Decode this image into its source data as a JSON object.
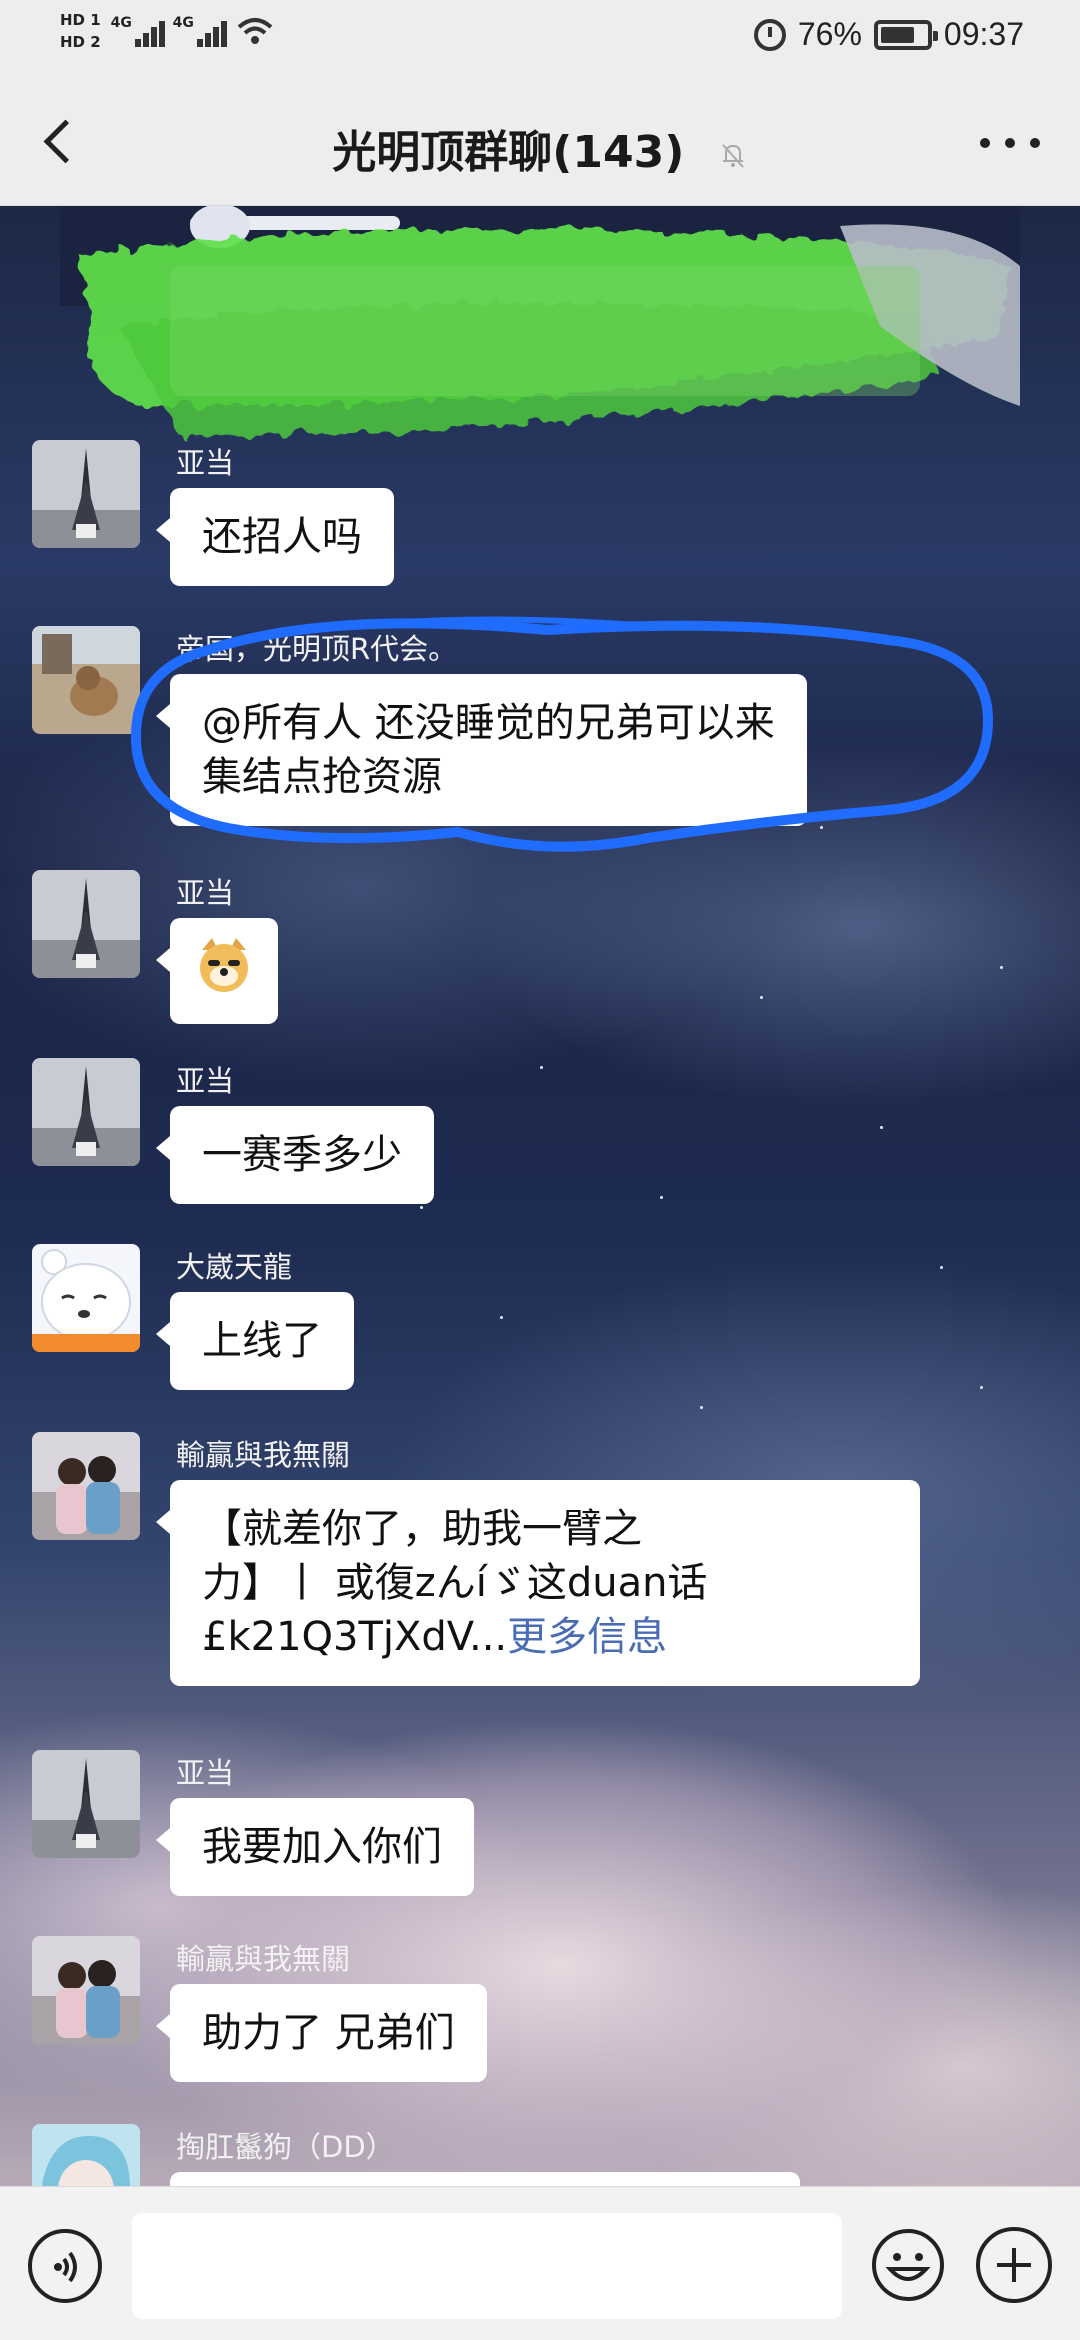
{
  "status_bar": {
    "hd1": "HD 1",
    "hd2": "HD 2",
    "sig1": "4G",
    "sig2": "4G",
    "battery": "76%",
    "time": "09:37",
    "icons": [
      "alarm-icon",
      "battery-icon",
      "wifi-icon",
      "signal-icon"
    ]
  },
  "header": {
    "title": "光明顶群聊(143)",
    "icons": [
      "back-icon",
      "mute-bell-icon",
      "more-icon"
    ]
  },
  "messages": [
    {
      "sender": "亚当",
      "lines": [
        "还招人吗"
      ]
    },
    {
      "sender": "帝国，光明顶R代会。",
      "lines": [
        "@所有人  还没睡觉的兄弟可以来",
        "集结点抢资源"
      ]
    },
    {
      "sender": "亚当",
      "lines": [
        "🐶"
      ]
    },
    {
      "sender": "亚当",
      "lines": [
        "一赛季多少"
      ]
    },
    {
      "sender": "大崴天龍",
      "lines": [
        "上线了"
      ]
    },
    {
      "sender": "輸贏與我無關",
      "lines": [
        "【就差你了，助我一臂之",
        "力】丨 或復zんíゞ这duan话",
        "£k21Q3TjXdV..."
      ],
      "link": "更多信息"
    },
    {
      "sender": "亚当",
      "lines": [
        "我要加入你们"
      ]
    },
    {
      "sender": "輸贏與我無關",
      "lines": [
        "助力了 兄弟们"
      ]
    },
    {
      "sender": "掏肛鬣狗（DD）",
      "lines": [
        ""
      ]
    }
  ],
  "input_bar": {
    "placeholder": "",
    "icons": [
      "voice-icon",
      "emoji-icon",
      "plus-icon"
    ]
  },
  "colors": {
    "bubble": "#ffffff",
    "link": "#4a6cb4",
    "scribble_green": "#5fe04a",
    "ring_blue": "#1f6cff"
  }
}
